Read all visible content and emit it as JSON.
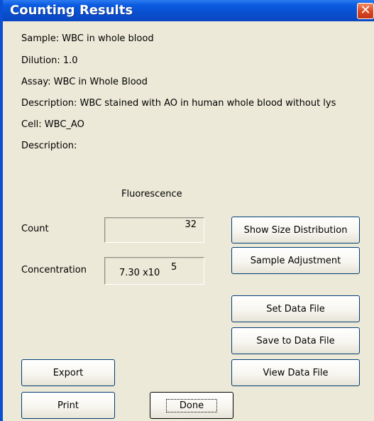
{
  "window": {
    "title": "Counting Results",
    "close_glyph": "✕"
  },
  "info": {
    "sample": "Sample: WBC in whole blood",
    "dilution": "Dilution: 1.0",
    "assay": "Assay: WBC in Whole Blood",
    "description1": "Description: WBC stained with AO in human whole blood without lys",
    "cell": "Cell: WBC_AO",
    "description2": "Description:"
  },
  "results": {
    "column_header": "Fluorescence",
    "count_label": "Count",
    "count_value": "32",
    "concentration_label": "Concentration",
    "concentration_mantissa": "7.30 x10",
    "concentration_exponent": "5"
  },
  "buttons": {
    "show_size_distribution": "Show Size Distribution",
    "sample_adjustment": "Sample Adjustment",
    "set_data_file": "Set Data File",
    "save_to_data_file": "Save to Data File",
    "view_data_file": "View Data File",
    "export": "Export",
    "print": "Print",
    "done": "Done"
  },
  "colors": {
    "titlebar": "#0a5ae0",
    "dialog_background": "#ece9d8",
    "close_button": "#d9451f"
  },
  "icons": {
    "close": "close-icon"
  }
}
